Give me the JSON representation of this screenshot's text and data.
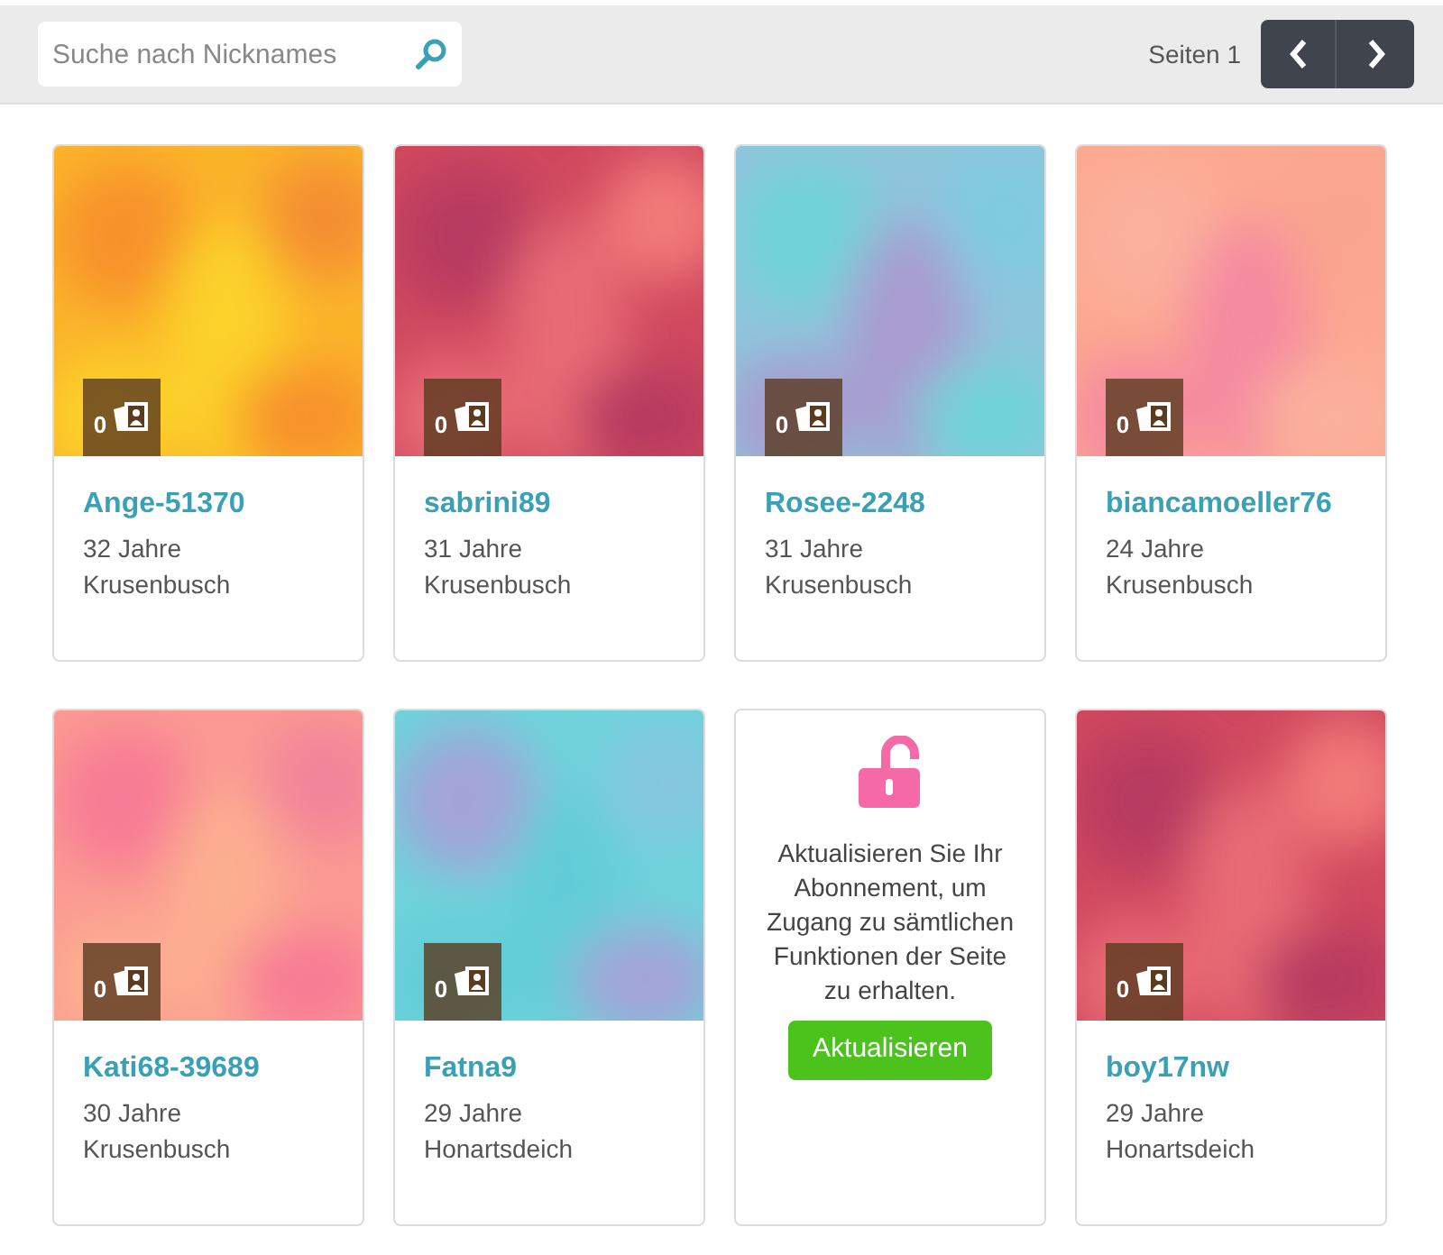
{
  "search": {
    "placeholder": "Suche nach Nicknames"
  },
  "pagination": {
    "label": "Seiten 1"
  },
  "cards": [
    {
      "kind": "profile",
      "name": "Ange-51370",
      "age": "32 Jahre",
      "place": "Krusenbusch",
      "photo_count": "0"
    },
    {
      "kind": "profile",
      "name": "sabrini89",
      "age": "31 Jahre",
      "place": "Krusenbusch",
      "photo_count": "0"
    },
    {
      "kind": "profile",
      "name": "Rosee-2248",
      "age": "31 Jahre",
      "place": "Krusenbusch",
      "photo_count": "0"
    },
    {
      "kind": "profile",
      "name": "biancamoeller76",
      "age": "24 Jahre",
      "place": "Krusenbusch",
      "photo_count": "0"
    },
    {
      "kind": "profile",
      "name": "Kati68-39689",
      "age": "30 Jahre",
      "place": "Krusenbusch",
      "photo_count": "0"
    },
    {
      "kind": "profile",
      "name": "Fatna9",
      "age": "29 Jahre",
      "place": "Honartsdeich",
      "photo_count": "0"
    },
    {
      "kind": "upgrade",
      "message": "Aktualisieren Sie Ihr Abonnement, um Zugang zu sämtlichen Funktionen der Seite zu erhalten.",
      "button": "Aktualisieren"
    },
    {
      "kind": "profile",
      "name": "boy17nw",
      "age": "29 Jahre",
      "place": "Honartsdeich",
      "photo_count": "0"
    }
  ]
}
